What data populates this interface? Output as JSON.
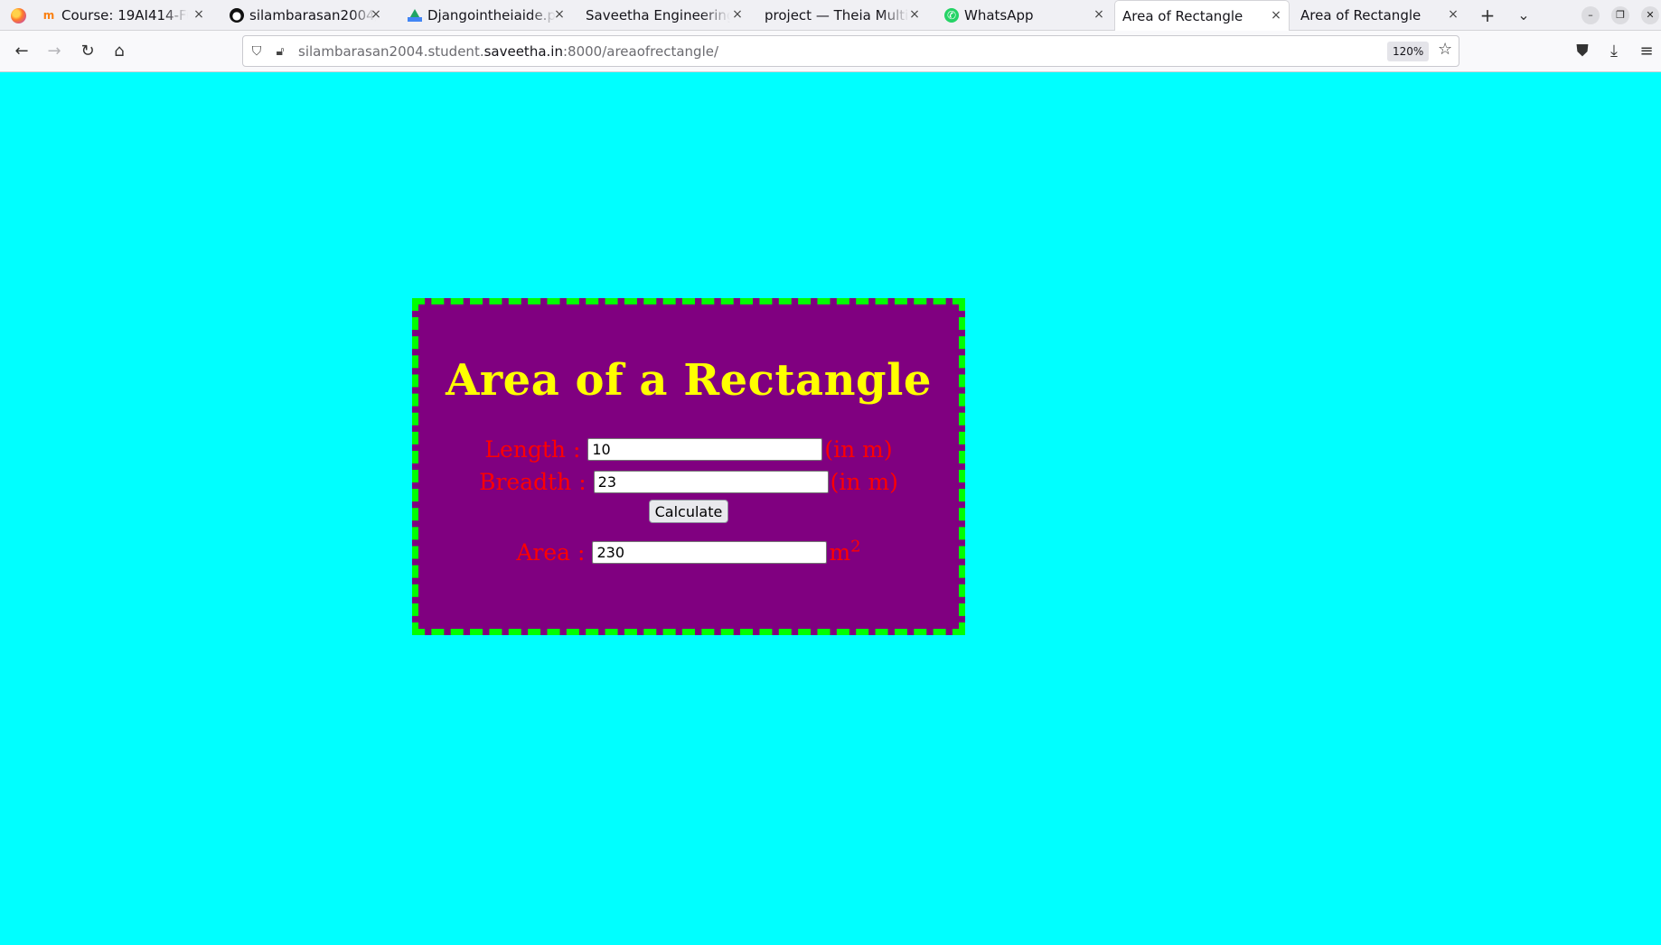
{
  "browser": {
    "tabs": [
      {
        "label": "Course: 19AI414-Fundamentals",
        "icon": "moodle-icon"
      },
      {
        "label": "silambarasan2004/set",
        "icon": "github-icon"
      },
      {
        "label": "Djangointheiaide.pdf",
        "icon": "google-drive-icon"
      },
      {
        "label": "Saveetha Engineering Co",
        "icon": "none"
      },
      {
        "label": "project — Theia Multi-La",
        "icon": "none"
      },
      {
        "label": "WhatsApp",
        "icon": "whatsapp-icon"
      },
      {
        "label": "Area of Rectangle",
        "icon": "none",
        "active": true
      },
      {
        "label": "Area of Rectangle",
        "icon": "none"
      }
    ],
    "close_glyph": "×",
    "new_tab_glyph": "+",
    "url": {
      "prefix": "silambarasan2004.student.",
      "host": "saveetha.in",
      "suffix": ":8000/areaofrectangle/"
    },
    "zoom": "120%"
  },
  "page": {
    "background": "#00ffff",
    "panel_background": "#800080",
    "panel_border_color": "#00ff00",
    "title": "Area of a Rectangle",
    "title_color": "#ffff00",
    "label_color": "#ff0000",
    "length": {
      "label": "Length :",
      "value": "10",
      "unit": "(in m)"
    },
    "breadth": {
      "label": "Breadth :",
      "value": "23",
      "unit": "(in m)"
    },
    "calculate_label": "Calculate",
    "area": {
      "label": "Area :",
      "value": "230",
      "unit": "m",
      "unit_exponent": "2"
    }
  }
}
